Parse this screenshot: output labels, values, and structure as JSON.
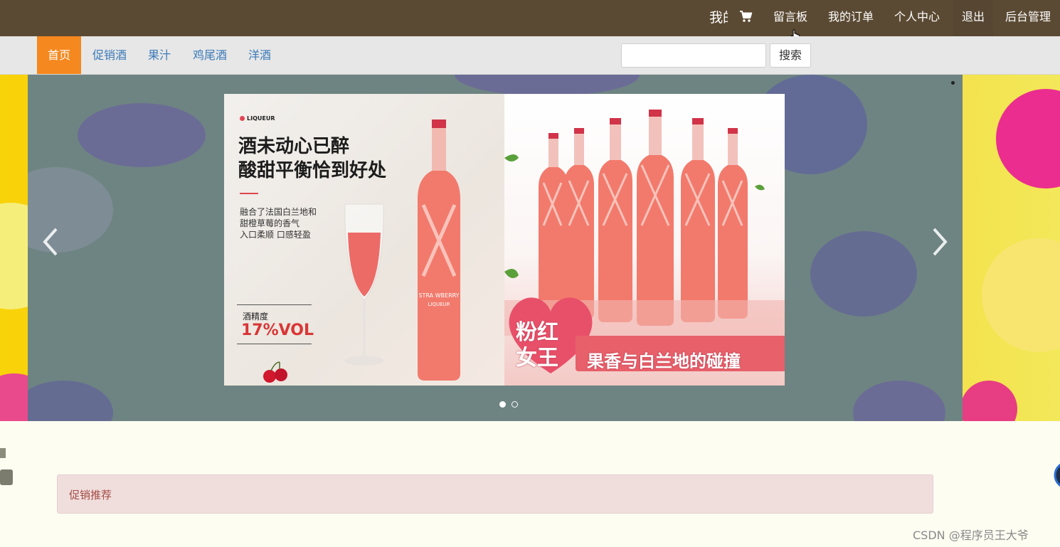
{
  "topbar": {
    "partial_label": "我的",
    "items": [
      "留言板",
      "我的订单",
      "个人中心",
      "退出",
      "后台管理"
    ]
  },
  "subnav": {
    "tabs": [
      "首页",
      "促销酒",
      "果汁",
      "鸡尾酒",
      "洋酒"
    ],
    "active_tab": 0,
    "search_value": "",
    "search_button": "搜索"
  },
  "carousel": {
    "brand": "LIQUEUR",
    "headline_line1": "酒未动心已醉",
    "headline_line2": "酸甜平衡恰到好处",
    "desc_line1": "融合了法国白兰地和",
    "desc_line2": "甜橙草莓的香气",
    "desc_line3": "入口柔顺 口感轻盈",
    "abv_label": "酒精度",
    "abv_value": "17%VOL",
    "bottle_label": "STRA WBERRY",
    "bottle_sublabel": "LIQUEUR",
    "heart_line1": "粉红",
    "heart_line2": "女王",
    "banner": "果香与白兰地的碰撞",
    "slide_count": 2,
    "active_slide": 0
  },
  "promo": {
    "title": "促销推荐"
  },
  "watermark": "CSDN @程序员王大爷",
  "colors": {
    "topbar": "#5b4a33",
    "subnav": "#e7e7e7",
    "active_tab": "#f5881f",
    "link": "#3b7ab8",
    "promo_bg": "#f0dedd",
    "promo_text": "#a24a42"
  }
}
